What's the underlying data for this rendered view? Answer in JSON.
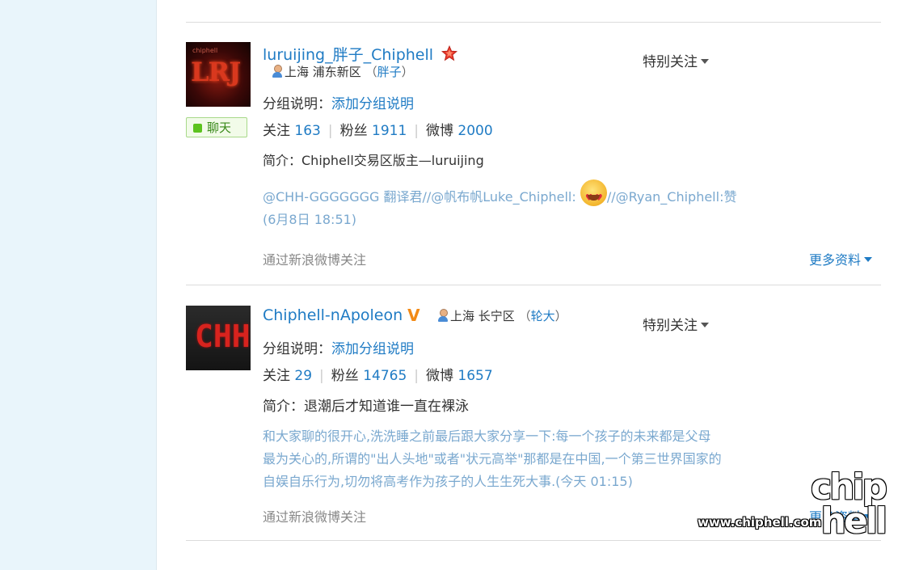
{
  "users": [
    {
      "name": "luruijing_胖子_Chiphell",
      "avatar_text": "LRJ",
      "avatar_small": "chiphell",
      "location": "上海 浦东新区",
      "nickname": "胖子",
      "paren_open": "（",
      "paren_close": "）",
      "follow_label": "特别关注",
      "chat_label": "聊天",
      "group_label": "分组说明：",
      "group_link": "添加分组说明",
      "following_label": "关注",
      "following_count": "163",
      "fans_label": "粉丝",
      "fans_count": "1911",
      "weibo_label": "微博",
      "weibo_count": "2000",
      "intro": "简介：Chiphell交易区版主—luruijing",
      "feed_before_emoji": "@CHH-GGGGGGG 翻译君//@帆布帆Luke_Chiphell: ",
      "feed_after_emoji": "//@Ryan_Chiphell:赞",
      "feed_time": "(6月8日 18:51)",
      "via": "通过新浪微博关注",
      "more_label": "更多资料",
      "badge_icon": "star-badge-icon"
    },
    {
      "name": "Chiphell-nApoleon",
      "avatar_text": "CHH",
      "location": "上海 长宁区",
      "nickname": "轮大",
      "paren_open": "（",
      "paren_close": "）",
      "follow_label": "特别关注",
      "group_label": "分组说明：",
      "group_link": "添加分组说明",
      "following_label": "关注",
      "following_count": "29",
      "fans_label": "粉丝",
      "fans_count": "14765",
      "weibo_label": "微博",
      "weibo_count": "1657",
      "intro": "简介：退潮后才知道谁一直在裸泳",
      "feed_line1": "和大家聊的很开心,洗洗睡之前最后跟大家分享一下:每一个孩子的未来都是父母",
      "feed_line2": "最为关心的,所谓的\"出人头地\"或者\"状元高举\"那都是在中国,一个第三世界国家的",
      "feed_line3": "自娱自乐行为,切勿将高考作为孩子的人生生死大事.(今天 01:15)",
      "via": "通过新浪微博关注",
      "more_label": "更多资料",
      "badge_icon": "verified-v-icon"
    }
  ],
  "watermark": {
    "top": "chip",
    "bottom": "hell",
    "url": "www.chiphell.com"
  }
}
